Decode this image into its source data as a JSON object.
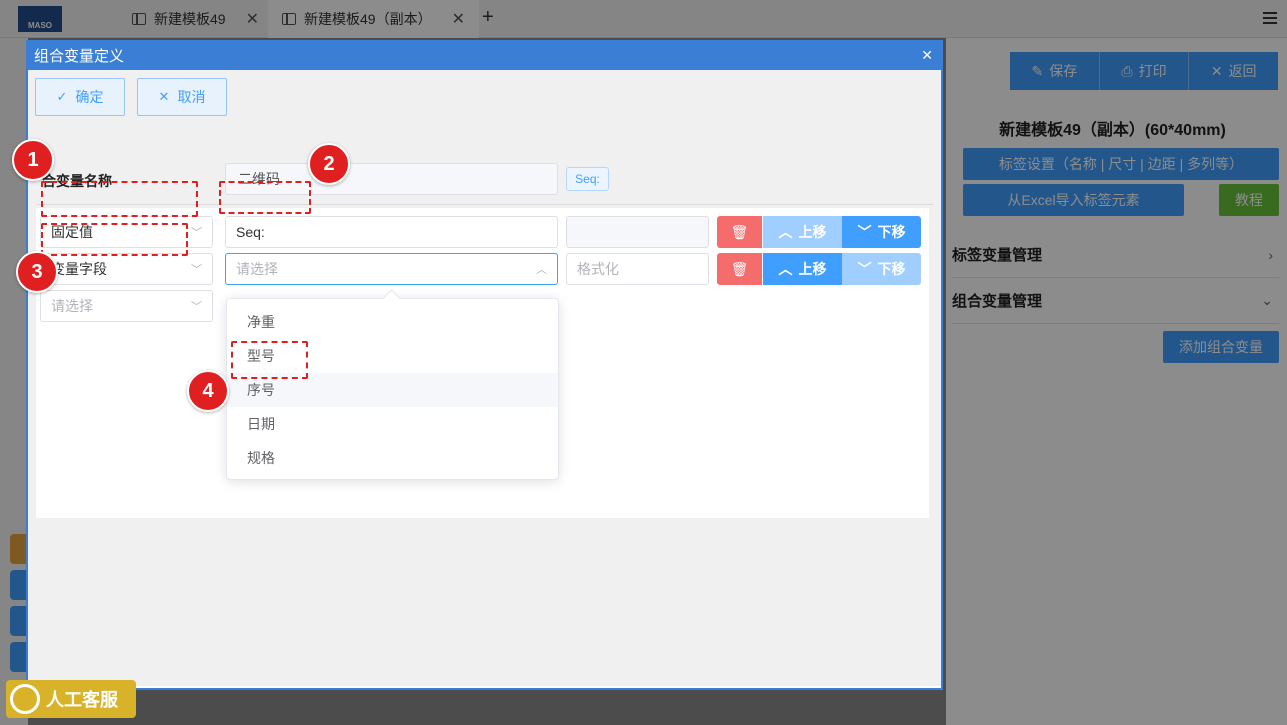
{
  "app": {
    "logo_text": "MASO",
    "tabs": [
      {
        "label": "新建模板49"
      },
      {
        "label": "新建模板49（副本）"
      }
    ],
    "add_tab": "+"
  },
  "right_panel": {
    "save": "保存",
    "print": "打印",
    "back": "返回",
    "title": "新建模板49（副本）(60*40mm)",
    "label_settings": "标签设置（名称 | 尺寸 | 边距 | 多列等）",
    "import_excel": "从Excel导入标签元素",
    "tutorial": "教程",
    "sections": [
      "标签变量管理",
      "组合变量管理"
    ],
    "add_combo_var": "添加组合变量"
  },
  "dialog": {
    "title": "组合变量定义",
    "confirm": "确定",
    "cancel": "取消",
    "name_label": "合变量名称",
    "name_value": "二维码",
    "seq_tag": "Seq:",
    "rows": [
      {
        "type": "固定值",
        "value": "Seq:",
        "format_placeholder": "",
        "delete": "🗑",
        "up": "上移",
        "down": "下移"
      },
      {
        "type": "变量字段",
        "value_placeholder": "请选择",
        "format_placeholder": "格式化",
        "delete": "🗑",
        "up": "上移",
        "down": "下移"
      },
      {
        "type_placeholder": "请选择"
      }
    ],
    "dropdown_options": [
      "净重",
      "型号",
      "序号",
      "日期",
      "规格"
    ]
  },
  "annotations": [
    "1",
    "2",
    "3",
    "4"
  ],
  "service": "人工客服",
  "colors": {
    "primary": "#409eff",
    "danger": "#f56c6c",
    "success": "#67c23a",
    "header": "#3a7fd5",
    "annotation": "#e02020"
  }
}
